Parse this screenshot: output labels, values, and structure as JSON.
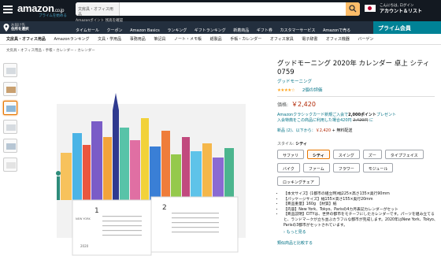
{
  "header": {
    "logo_text": "amazon",
    "logo_suffix": ".co.jp",
    "logo_sub": "プライムを始める",
    "search_category": "文房具・オフィス用品",
    "search_placeholder": "",
    "account_greeting": "こんにちは, ログイン",
    "account_label": "アカウント＆リスト"
  },
  "subheader": {
    "deliver_line1": "お届け先",
    "deliver_line2": "住所を選択",
    "points_text": "Amazonポイント 残高を確認",
    "links": [
      "タイムセール",
      "クーポン",
      "Amazon Basics",
      "ランキング",
      "ギフトランキング",
      "新着商品",
      "ギフト券",
      "カスタマーサービス",
      "Amazonで売る"
    ],
    "prime_banner": "プライム会員"
  },
  "categories": [
    "文房具・オフィス用品",
    "Amazonランキング",
    "文具・学用品",
    "事務用品",
    "筆記具",
    "ノート・メモ帳",
    "紙製品",
    "手帳・カレンダー",
    "オフィス家具",
    "電子辞書",
    "オフィス機器",
    "バーゲン"
  ],
  "breadcrumb": "文房具・オフィス用品 › 手帳・カレンダー › カレンダー",
  "product": {
    "title": "グッドモーニング 2020年 カレンダー 卓上 シティ 0759",
    "brand": "グッドモーニング",
    "stars": "★★★★☆",
    "rating_count": "2個の評価",
    "price_label": "価格:",
    "price": "￥2,420",
    "card_line1_prefix": "Amazonクラシックカード新規ご入会で",
    "card_points": "2,000ポイント",
    "card_line1_suffix": "プレゼント",
    "card_line2_prefix": "入会特典をこの商品に利用した場合420円 ",
    "card_old_price": "2,420円",
    "card_line2_suffix": " に",
    "used_prefix": "新品 (2)、以下から：",
    "used_price": "￥2,420",
    "used_suffix": " + 無料配送",
    "style_label": "スタイル:",
    "style_value": "シティ",
    "style_options": [
      "サファリ",
      "シティ",
      "スイング",
      "ズー",
      "タイプフェイス",
      "バイク",
      "ファーム",
      "フラワー",
      "モジュール",
      "ロッキングチェア"
    ],
    "selected_index": 1,
    "bullets": [
      "【本文サイズ】(1都市の組立時)幅225×高さ135×奥行90mm",
      "【パッケージサイズ】幅155×高さ155×奥行20mm",
      "【商品重量】160g　【材質】紙",
      "【内容】New York、Tokyo、Parisの4カ月表記カレンダーがセット",
      "【商品説明】CITYは、世界の都市をモチーフにしたカレンダーです。パーツを組み立てると、ランドマークが立ち並ぶカラフルな都市が完成します。2020年はNew York、Tokyo、Parisの3都市がセットされています。"
    ],
    "more_link": "› もっと見る",
    "compare_link": "類似商品と比較する"
  },
  "calendar_image": {
    "month_a": "1",
    "month_b": "2",
    "year_label": "2020",
    "city_label": "NEW YORK"
  },
  "colors": {
    "nav_dark": "#131921",
    "nav_sub": "#232f3e",
    "accent": "#febd69",
    "prime": "#008296",
    "price": "#b12704",
    "link": "#007185",
    "star": "#ffa41c"
  }
}
